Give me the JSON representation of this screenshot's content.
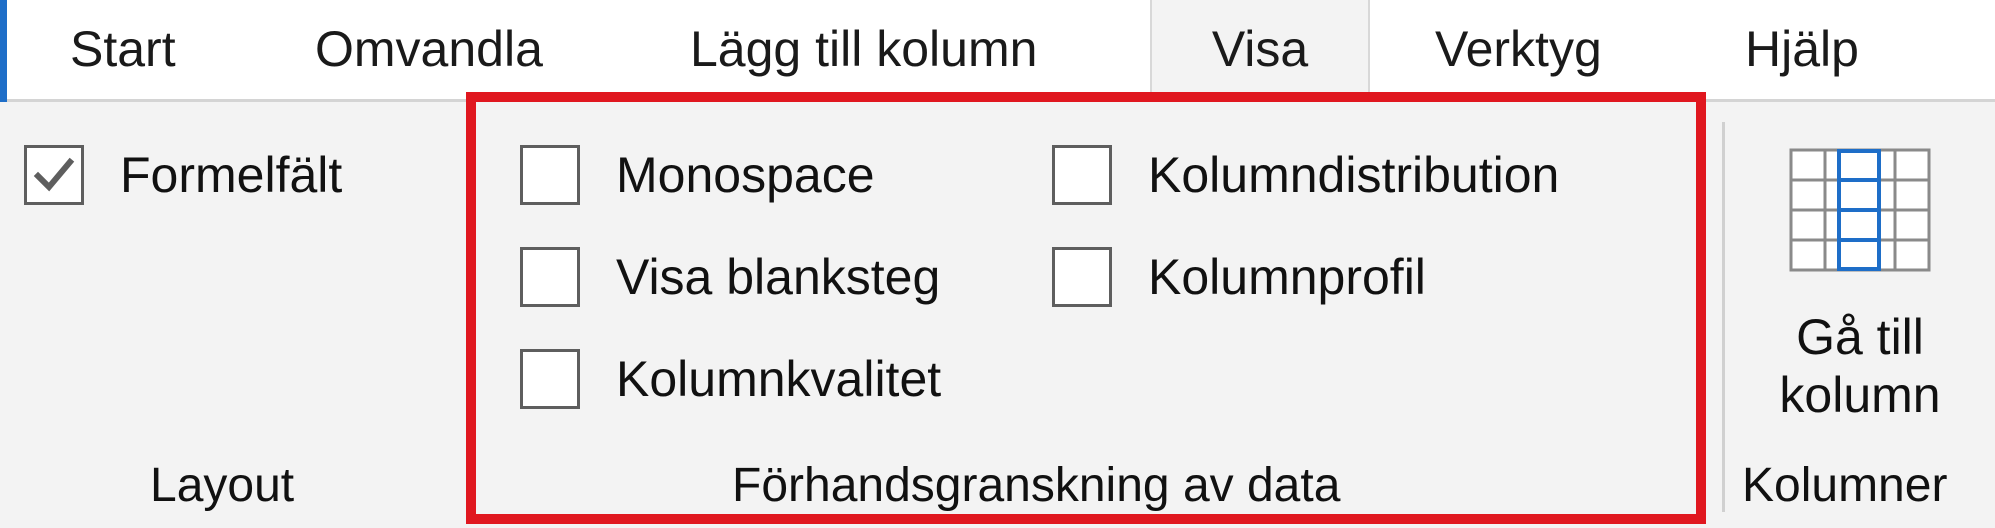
{
  "tabs": [
    {
      "label": "Start"
    },
    {
      "label": "Omvandla"
    },
    {
      "label": "Lägg till kolumn"
    },
    {
      "label": "Visa"
    },
    {
      "label": "Verktyg"
    },
    {
      "label": "Hjälp"
    }
  ],
  "layout_group": {
    "formula_bar": {
      "label": "Formelfält",
      "checked": true
    },
    "label": "Layout"
  },
  "preview_group": {
    "monospace": {
      "label": "Monospace",
      "checked": false
    },
    "show_whitespace": {
      "label": "Visa blanksteg",
      "checked": false
    },
    "column_quality": {
      "label": "Kolumnkvalitet",
      "checked": false
    },
    "column_distribution": {
      "label": "Kolumndistribution",
      "checked": false
    },
    "column_profile": {
      "label": "Kolumnprofil",
      "checked": false
    },
    "label": "Förhandsgranskning av data"
  },
  "columns_group": {
    "goto_column": {
      "line1": "Gå till",
      "line2": "kolumn"
    },
    "label": "Kolumner"
  },
  "colors": {
    "highlight": "#e0171f",
    "accent": "#1e6ec8"
  },
  "icons": {
    "checkmark": "check-icon",
    "goto_column": "table-column-icon"
  }
}
